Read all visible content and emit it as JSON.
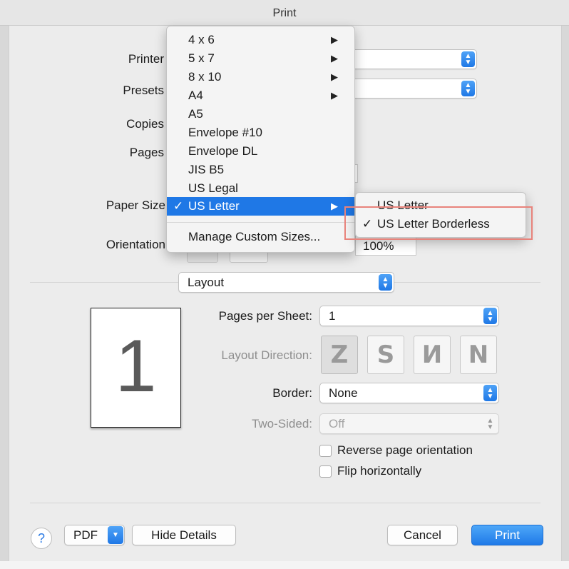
{
  "window": {
    "title": "Print"
  },
  "printer_section": {
    "printer_label": "Printer",
    "presets_label": "Presets",
    "copies_label": "Copies",
    "pages_label": "Pages",
    "paper_size_label": "Paper Size",
    "orientation_label": "Orientation",
    "scale_value": "100%"
  },
  "paper_size_menu": {
    "items": [
      {
        "label": "4 x 6",
        "submenu": true
      },
      {
        "label": "5 x 7",
        "submenu": true
      },
      {
        "label": "8 x 10",
        "submenu": true
      },
      {
        "label": "A4",
        "submenu": true
      },
      {
        "label": "A5",
        "submenu": false
      },
      {
        "label": "Envelope #10",
        "submenu": false
      },
      {
        "label": "Envelope DL",
        "submenu": false
      },
      {
        "label": "JIS B5",
        "submenu": false
      },
      {
        "label": "US Legal",
        "submenu": false
      },
      {
        "label": "US Letter",
        "submenu": true,
        "selected": true,
        "highlighted": true
      }
    ],
    "manage_label": "Manage Custom Sizes...",
    "check_glyph": "✓",
    "submenu_glyph": "▶"
  },
  "us_letter_submenu": {
    "items": [
      {
        "label": "US Letter",
        "checked": false
      },
      {
        "label": "US Letter Borderless",
        "checked": true
      }
    ]
  },
  "section_popup": {
    "value": "Layout"
  },
  "layout": {
    "preview_page_number": "1",
    "pages_per_sheet_label": "Pages per Sheet:",
    "pages_per_sheet_value": "1",
    "layout_direction_label": "Layout Direction:",
    "border_label": "Border:",
    "border_value": "None",
    "two_sided_label": "Two-Sided:",
    "two_sided_value": "Off",
    "reverse_label": "Reverse page orientation",
    "flip_label": "Flip horizontally"
  },
  "footer": {
    "help_glyph": "?",
    "pdf_label": "PDF",
    "hide_details_label": "Hide Details",
    "cancel_label": "Cancel",
    "print_label": "Print"
  },
  "colors": {
    "accent": "#1f78e6",
    "annotation_box": "#e8837b"
  }
}
